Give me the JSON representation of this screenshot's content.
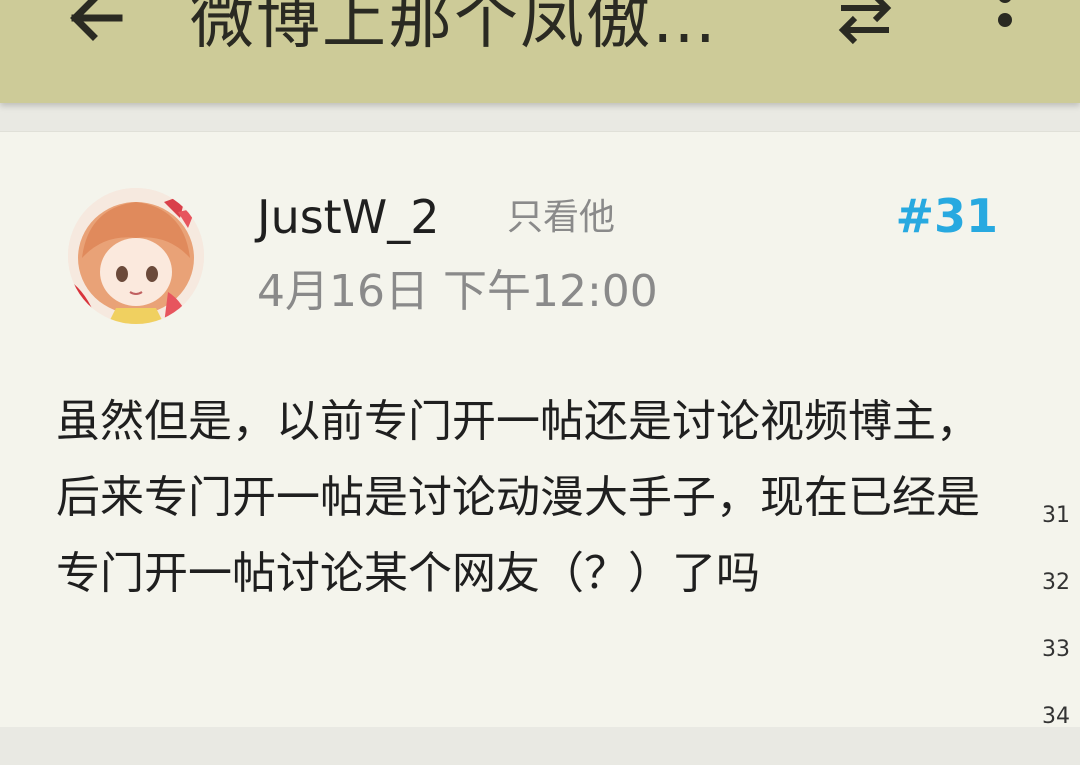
{
  "header": {
    "title": "微博上那个凤傲…",
    "back_icon": "arrow-left-icon",
    "swap_icon": "swap-icon",
    "more_icon": "more-vert-icon",
    "background": "#cdcb98"
  },
  "post": {
    "username": "JustW_2",
    "only_him": "只看他",
    "floor": "#31",
    "timestamp": "4月16日 下午12:00",
    "content": "虽然但是，以前专门开一帖还是讨论视频博主，后来专门开一帖是讨论动漫大手子，现在已经是专门开一帖讨论某个网友（？）了吗",
    "floor_color": "#27a9e0"
  },
  "scroll_index": [
    "31",
    "32",
    "33",
    "34"
  ]
}
